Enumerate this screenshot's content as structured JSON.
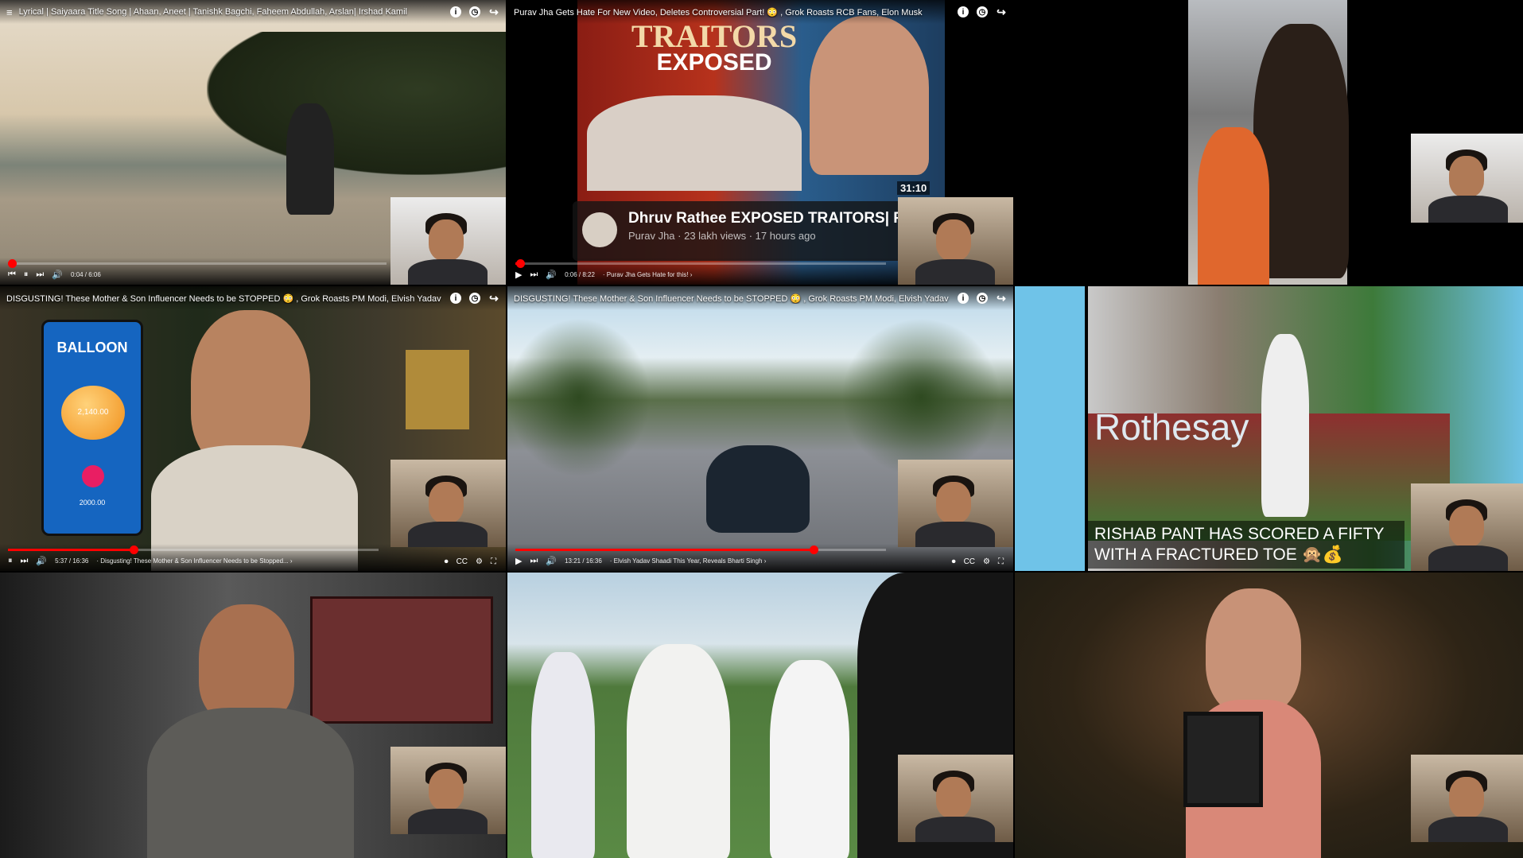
{
  "tiles": [
    {
      "title": "Lyrical | Saiyaara Title Song | Ahaan, Aneet | Tanishk Bagchi, Faheem Abdullah, Arslan| Irshad Kamil",
      "time": "0:04 / 6:06",
      "progress": 0.011
    },
    {
      "title": "Purav Jha Gets Hate For New Video, Deletes Controversial Part! 😳 , Grok Roasts RCB Fans, Elon Musk",
      "thumb_headline_1": "TRAITORS",
      "thumb_headline_2": "EXPOSED",
      "duration": "31:10",
      "card_title": "Dhruv Rathee EXPOSED TRAITORS| Purav Jha | @the.rebelkid @raftaa...",
      "card_sub": "Purav Jha · 23 lakh views · 17 hours ago",
      "time": "0:06 / 8:22",
      "chapter": "· Purav Jha Gets Hate for this! ›",
      "progress": 0.012
    },
    {
      "title": ""
    },
    {
      "title": "DISGUSTING! These Mother & Son Influencer Needs to be STOPPED 😳 , Grok Roasts PM Modi, Elvish Yadav",
      "phone_title": "BALLOON",
      "phone_balloon": "2,140.00",
      "phone_amount": "2000.00",
      "time": "5:37 / 16:36",
      "chapter": "· Disgusting! These Mother & Son Influencer Needs to be Stopped... ›",
      "progress": 0.338
    },
    {
      "title": "DISGUSTING! These Mother & Son Influencer Needs to be STOPPED 😳 , Grok Roasts PM Modi, Elvish Yadav",
      "time": "13:21 / 16:36",
      "chapter": "· Elvish Yadav Shaadi This Year, Reveals Bharti Singh ›",
      "progress": 0.804
    },
    {
      "title": "",
      "board_text": "Rothesay",
      "caption": "RISHAB PANT HAS SCORED A FIFTY WITH A FRACTURED TOE 🙊💰"
    },
    {
      "title": ""
    },
    {
      "title": ""
    },
    {
      "title": ""
    }
  ],
  "icons": {
    "menu": "menu-icon",
    "info": "info-icon",
    "clock": "clock-icon",
    "share": "share-icon"
  }
}
